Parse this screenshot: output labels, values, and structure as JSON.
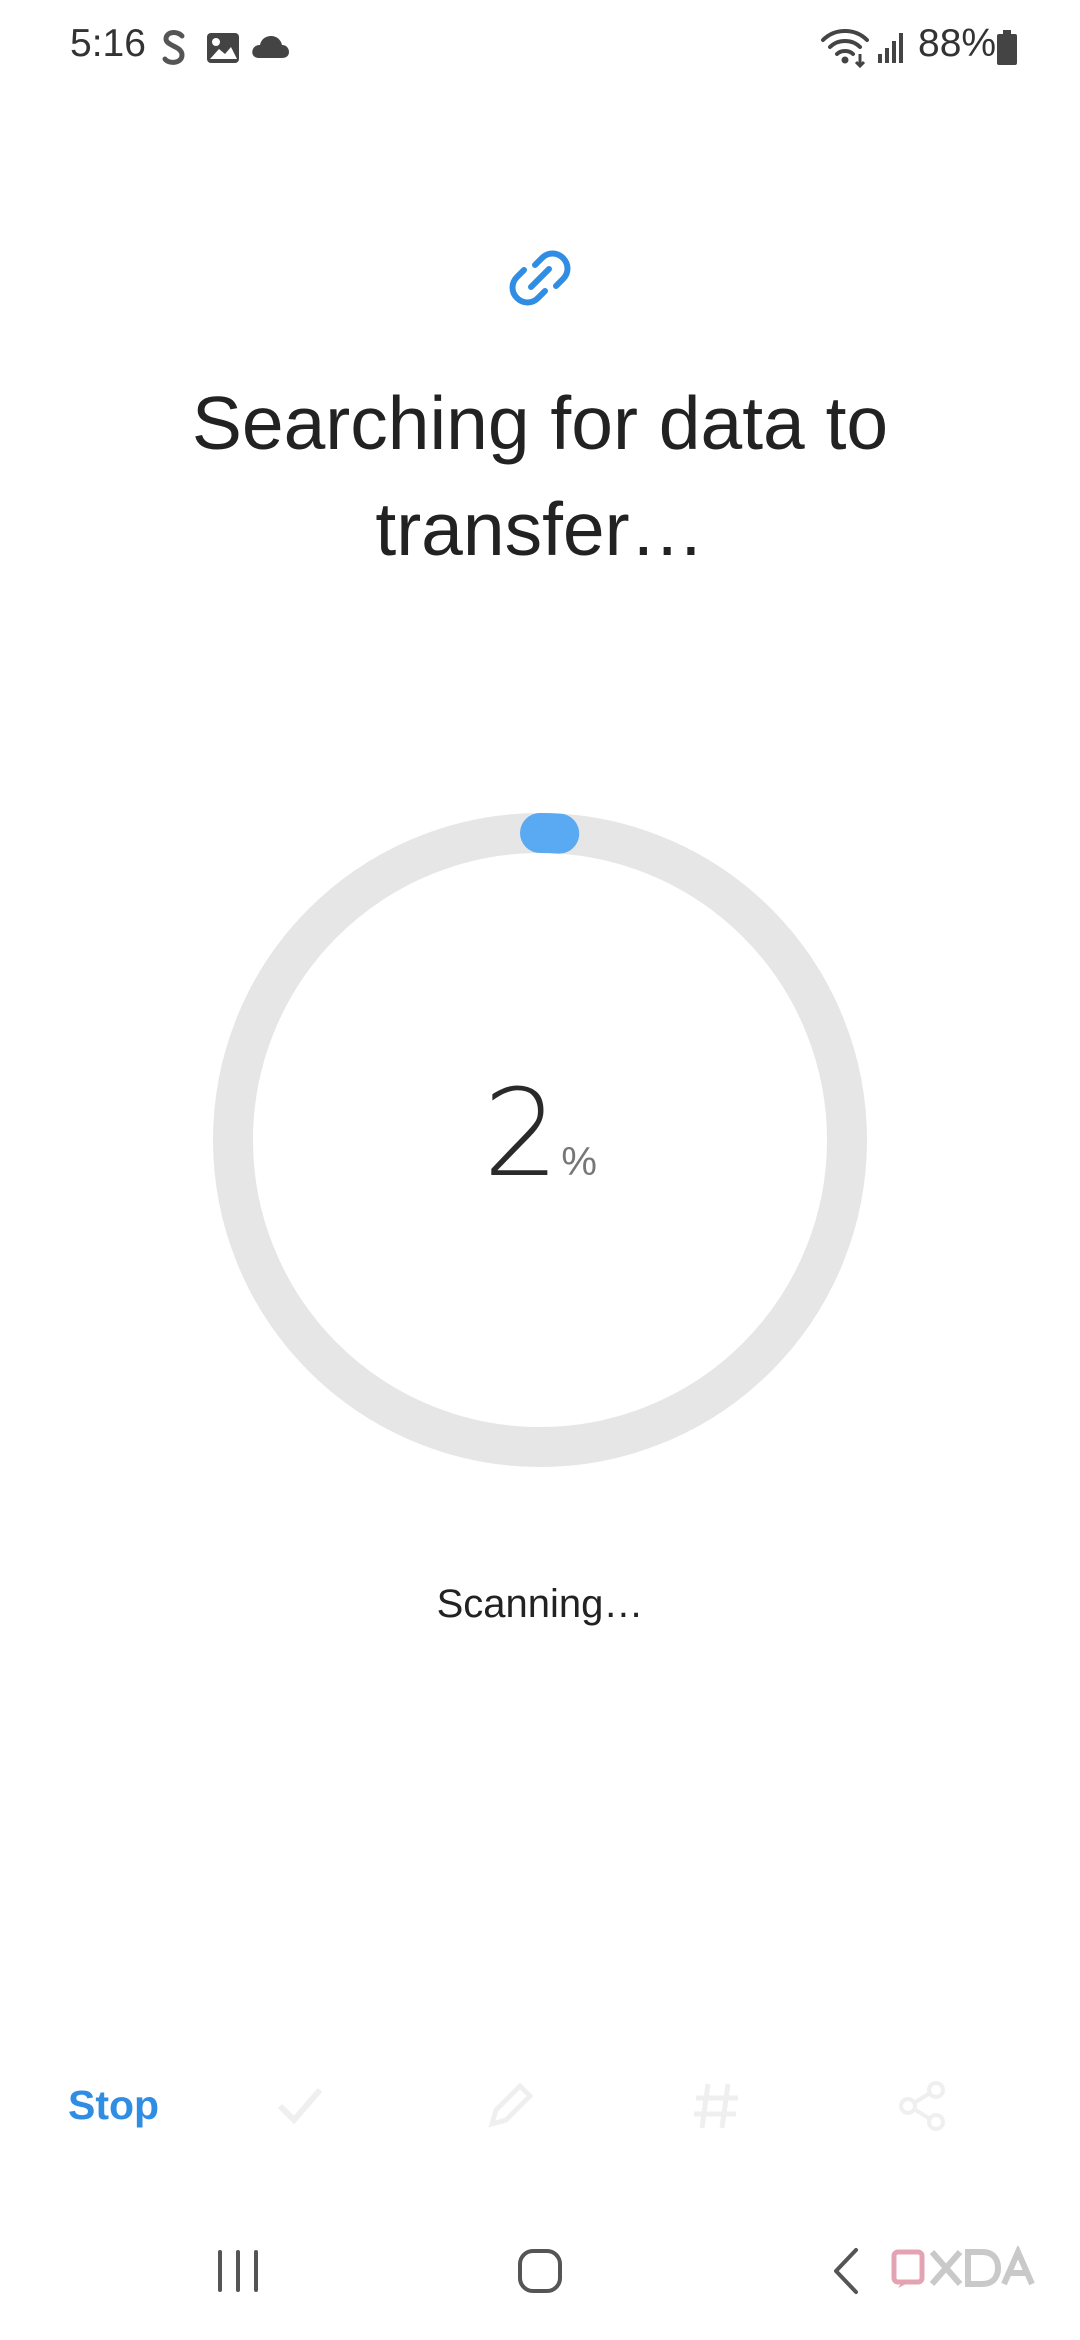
{
  "status_bar": {
    "time": "5:16",
    "battery": "88%",
    "icons": [
      "s-app-icon",
      "gallery-icon",
      "cloud-icon",
      "wifi-icon",
      "signal-icon",
      "battery-icon"
    ]
  },
  "screen": {
    "header_icon": "link-icon",
    "title": "Searching for data to transfer…",
    "progress": {
      "value": 2,
      "unit": "%"
    },
    "status_text": "Scanning…"
  },
  "bottom_bar": {
    "stop_label": "Stop",
    "disabled_icons": [
      "select-icon",
      "edit-icon",
      "hashtag-icon",
      "share-icon"
    ]
  },
  "nav_bar": {
    "buttons": [
      "recents-button",
      "home-button",
      "back-button"
    ]
  },
  "watermark": {
    "text": "XDA"
  },
  "colors": {
    "accent": "#2f8de4",
    "progress_arc": "#5aa9f3",
    "track": "#e6e6e6",
    "text_primary": "#222222"
  }
}
